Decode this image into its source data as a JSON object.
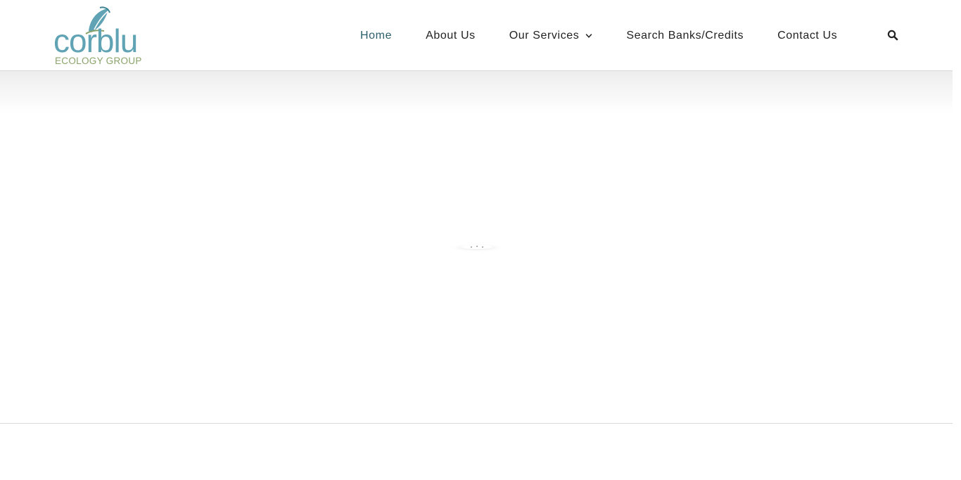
{
  "brand": {
    "logo_text": "corblu",
    "logo_subtext": "ECOLOGY GROUP",
    "primary_color": "#5fa3b4",
    "secondary_color": "#8aa36b"
  },
  "nav": {
    "items": [
      {
        "label": "Home",
        "active": true
      },
      {
        "label": "About Us",
        "active": false
      },
      {
        "label": "Our Services",
        "active": false,
        "has_dropdown": true
      },
      {
        "label": "Search Banks/Credits",
        "active": false
      },
      {
        "label": "Contact Us",
        "active": false
      }
    ],
    "active_color": "#2b5f6a",
    "text_color": "#222222",
    "search_icon": "search-icon",
    "dropdown_icon": "chevron-down-icon"
  },
  "content": {
    "loader_icon": "loading-spinner-icon"
  }
}
